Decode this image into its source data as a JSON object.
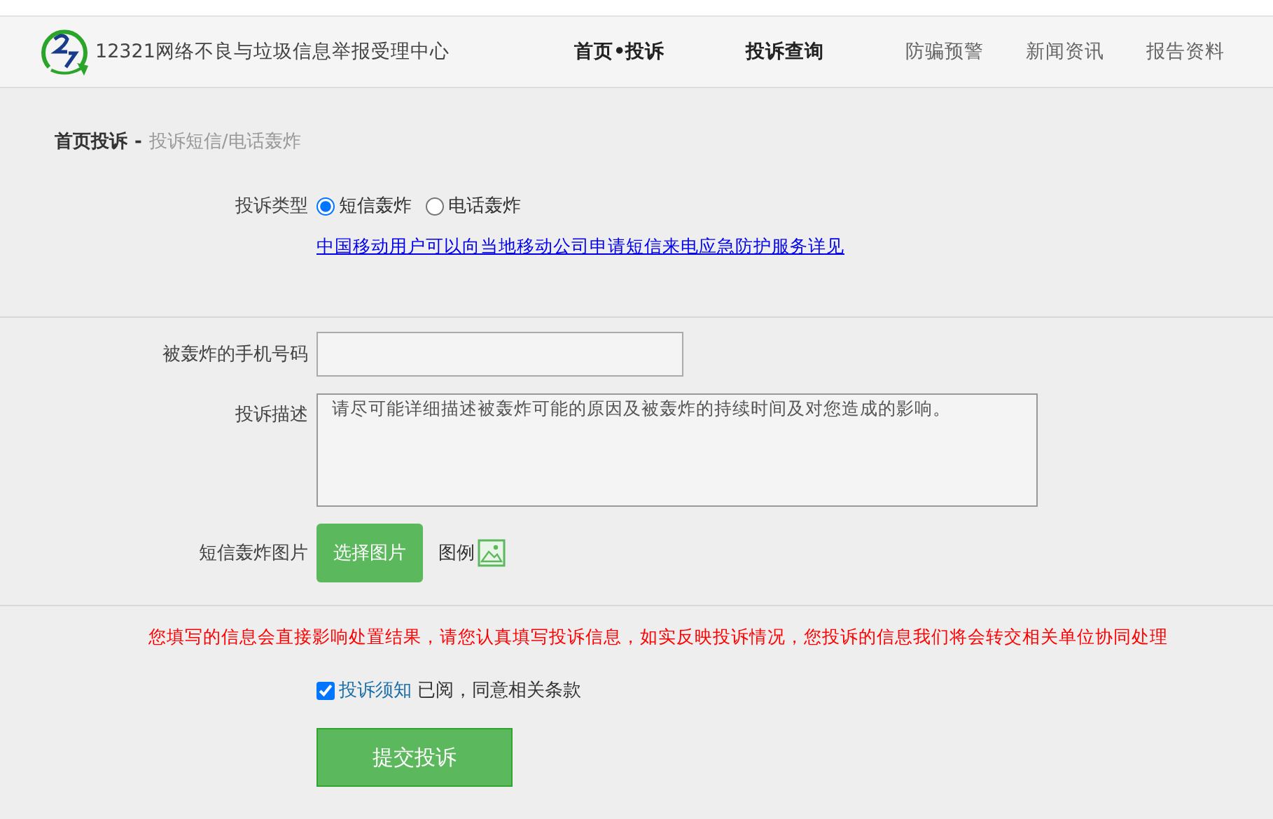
{
  "header": {
    "site_title": "12321网络不良与垃圾信息举报受理中心",
    "nav": [
      {
        "label": "首页•投诉",
        "selected": true
      },
      {
        "label": "投诉查询",
        "selected": true
      },
      {
        "label": "防骗预警",
        "selected": false
      },
      {
        "label": "新闻资讯",
        "selected": false
      },
      {
        "label": "报告资料",
        "selected": false
      }
    ]
  },
  "breadcrumb": {
    "current": "首页投诉",
    "separator": "-",
    "page": "投诉短信/电话轰炸"
  },
  "complaint_type": {
    "label": "投诉类型",
    "options": [
      {
        "label": "短信轰炸",
        "selected": true
      },
      {
        "label": "电话轰炸",
        "selected": false
      }
    ],
    "link": "中国移动用户可以向当地移动公司申请短信来电应急防护服务详见"
  },
  "phone": {
    "label": "被轰炸的手机号码"
  },
  "description": {
    "label": "投诉描述",
    "placeholder": "请尽可能详细描述被轰炸可能的原因及被轰炸的持续时间及对您造成的影响。"
  },
  "image": {
    "label": "短信轰炸图片",
    "button": "选择图片",
    "example": "图例"
  },
  "warning": "您填写的信息会直接影响处置结果，请您认真填写投诉信息，如实反映投诉情况，您投诉的信息我们将会转交相关单位协同处理",
  "agreement": {
    "checked": true,
    "link": "投诉须知",
    "text": "已阅，同意相关条款"
  },
  "submit": "提交投诉"
}
